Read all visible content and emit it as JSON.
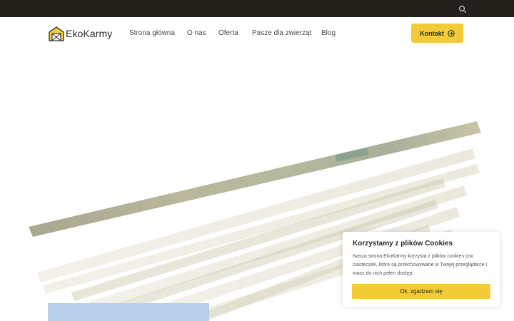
{
  "topbar": {
    "search_icon": "search-icon",
    "background": "#24211c"
  },
  "header": {
    "logo_text": "EkoKarmy",
    "nav": [
      {
        "label": "Strona główna"
      },
      {
        "label": "O nas"
      },
      {
        "label": "Oferta"
      },
      {
        "label": "Pasze dla zwierząt"
      },
      {
        "label": "Blog"
      }
    ],
    "contact_label": "Kontakt",
    "accent": "#f2cb36"
  },
  "cookie": {
    "title": "Korzystamy z plików Cookies",
    "text": "Nasza strona EkoKarmy korzysta z plików cookies tzw. ciasteczek, które są przechowywane w Twojej przeglądarce i masz do nich pełen dostęp.",
    "accept_label": "Ok, zgadzam się"
  }
}
